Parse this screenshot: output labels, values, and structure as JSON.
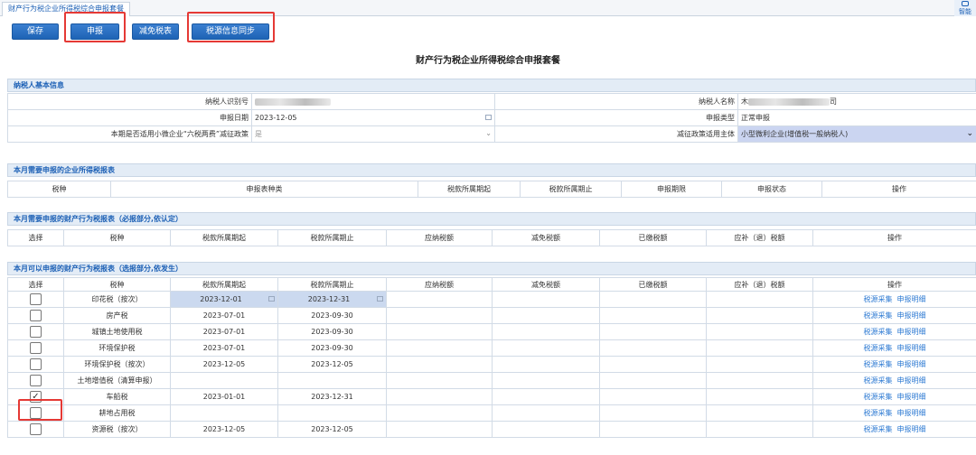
{
  "tab": {
    "label": "财产行为税企业所得税综合申报套餐"
  },
  "smart": {
    "label": "智能"
  },
  "toolbar": {
    "save": "保存",
    "declare": "申报",
    "relief": "减免税表",
    "sync": "税源信息同步"
  },
  "page_title": "财产行为税企业所得税综合申报套餐",
  "taxpayer": {
    "section_title": "纳税人基本信息",
    "id_label": "纳税人识别号",
    "name_label": "纳税人名称",
    "name_prefix": "木",
    "name_suffix": "司",
    "date_label": "申报日期",
    "date_value": "2023-12-05",
    "type_label": "申报类型",
    "type_value": "正常申报",
    "policy_label": "本期是否适用小微企业“六税两费”减征政策",
    "policy_value": "是",
    "subject_label": "减征政策适用主体",
    "subject_value": "小型微利企业(增值税一般纳税人)"
  },
  "section_income": {
    "title": "本月需要申报的企业所得税报表",
    "headers": [
      "税种",
      "申报表种类",
      "税款所属期起",
      "税款所属期止",
      "申报期限",
      "申报状态",
      "操作"
    ]
  },
  "section_required": {
    "title": "本月需要申报的财产行为税报表（必报部分,依认定）",
    "headers": [
      "选择",
      "税种",
      "税款所属期起",
      "税款所属期止",
      "应纳税额",
      "减免税额",
      "已缴税额",
      "应补（退）税额",
      "操作"
    ]
  },
  "section_optional": {
    "title": "本月可以申报的财产行为税报表（选报部分,依发生）",
    "headers": [
      "选择",
      "税种",
      "税款所属期起",
      "税款所属期止",
      "应纳税额",
      "减免税额",
      "已缴税额",
      "应补（退）税额",
      "操作"
    ],
    "link_collect": "税源采集",
    "link_detail": "申报明细",
    "check_mark": "✓",
    "rows": [
      {
        "tax": "印花税（按次）",
        "start": "2023-12-01",
        "end": "2023-12-31",
        "checked": false,
        "highlight": true
      },
      {
        "tax": "房产税",
        "start": "2023-07-01",
        "end": "2023-09-30",
        "checked": false,
        "highlight": false
      },
      {
        "tax": "城镇土地使用税",
        "start": "2023-07-01",
        "end": "2023-09-30",
        "checked": false,
        "highlight": false
      },
      {
        "tax": "环境保护税",
        "start": "2023-07-01",
        "end": "2023-09-30",
        "checked": false,
        "highlight": false
      },
      {
        "tax": "环境保护税（按次）",
        "start": "2023-12-05",
        "end": "2023-12-05",
        "checked": false,
        "highlight": false
      },
      {
        "tax": "土地增值税（清算申报）",
        "start": "",
        "end": "",
        "checked": false,
        "highlight": false
      },
      {
        "tax": "车船税",
        "start": "2023-01-01",
        "end": "2023-12-31",
        "checked": true,
        "highlight": false
      },
      {
        "tax": "耕地占用税",
        "start": "",
        "end": "",
        "checked": false,
        "highlight": false
      },
      {
        "tax": "资源税（按次）",
        "start": "2023-12-05",
        "end": "2023-12-05",
        "checked": false,
        "highlight": false
      }
    ]
  }
}
